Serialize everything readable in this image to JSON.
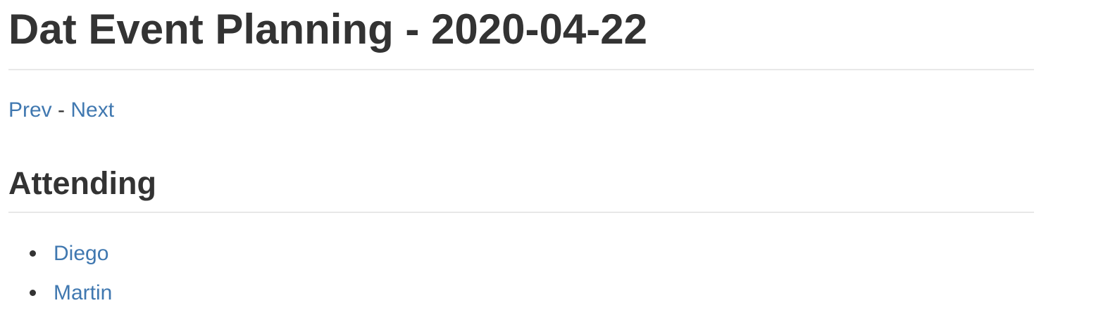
{
  "page": {
    "title": "Dat Event Planning - 2020-04-22"
  },
  "nav": {
    "prev_label": "Prev",
    "separator": "-",
    "next_label": "Next"
  },
  "attending": {
    "heading": "Attending",
    "attendees": [
      {
        "name": "Diego"
      },
      {
        "name": "Martin"
      }
    ]
  },
  "colors": {
    "text": "#333333",
    "link": "#4078b0",
    "rule": "#e8e8e8"
  }
}
